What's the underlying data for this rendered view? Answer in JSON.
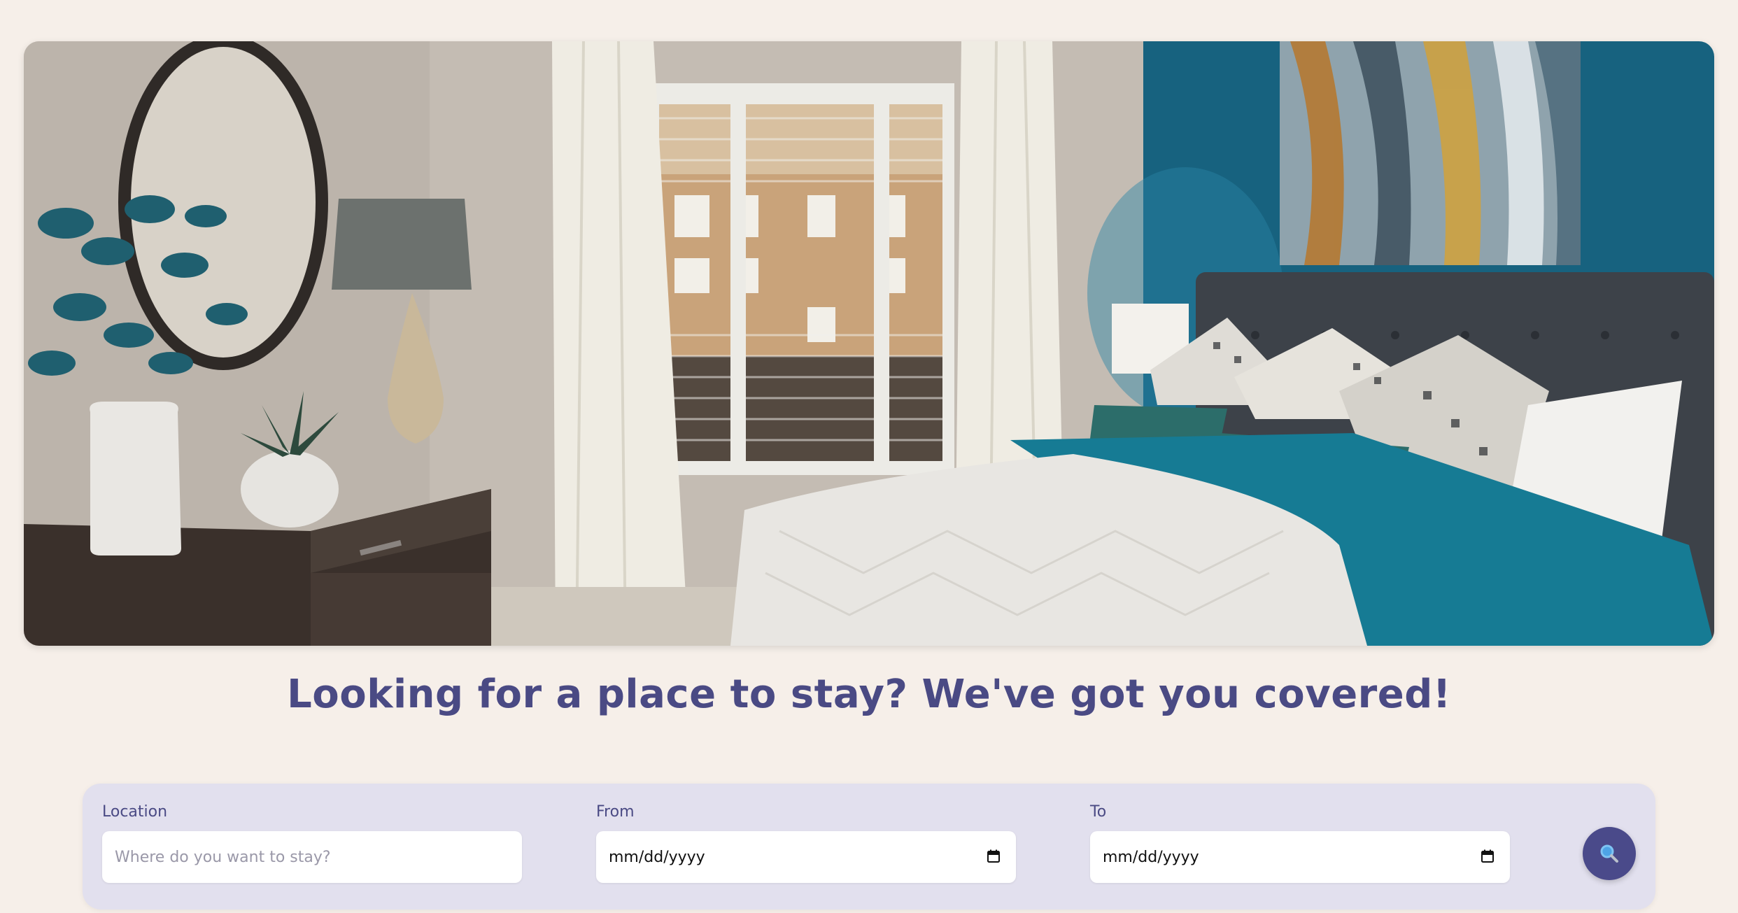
{
  "hero": {
    "image": "bedroom-photo",
    "alt_subject": "bedroom"
  },
  "headline": "Looking for a place to stay? We've got you covered!",
  "search": {
    "location": {
      "label": "Location",
      "placeholder": "Where do you want to stay?"
    },
    "from": {
      "label": "From",
      "value": "mm/dd/yyyy"
    },
    "to": {
      "label": "To",
      "value": "mm/dd/yyyy"
    },
    "button_icon": "magnifier-icon"
  },
  "colors": {
    "background": "#f6efe9",
    "accent": "#4a4a84",
    "panel": "#e2e0ee",
    "wall_teal": "#17627f"
  }
}
